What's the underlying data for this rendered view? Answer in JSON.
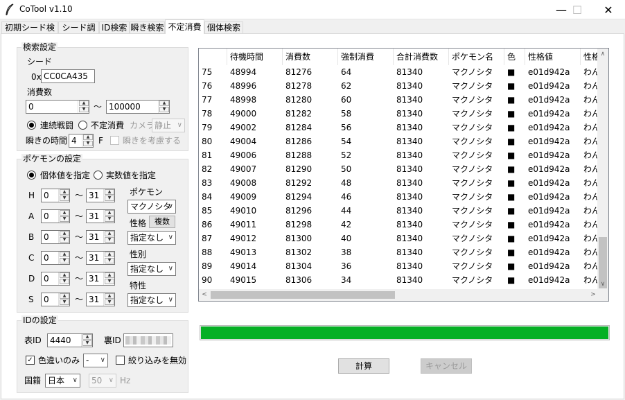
{
  "window": {
    "title": "CoTool v1.10"
  },
  "tabs": [
    {
      "label": "初期シード検索",
      "active": false
    },
    {
      "label": "シード調整",
      "active": false
    },
    {
      "label": "ID検索",
      "active": false
    },
    {
      "label": "瞬き検索",
      "active": false
    },
    {
      "label": "不定消費",
      "active": true
    },
    {
      "label": "個体検索",
      "active": false
    }
  ],
  "search": {
    "group_title": "検索設定",
    "seed_label": "シード",
    "seed_prefix": "0x",
    "seed_value": "CC0CA435",
    "consume_label": "消費数",
    "consume_min": "0",
    "consume_max": "100000",
    "tilde": "～",
    "mode_battle": "連続戦闘",
    "mode_indef": "不定消費",
    "camera_label": "カメラ",
    "camera_value": "静止",
    "blink_label": "瞬きの時間",
    "blink_value": "4",
    "blink_unit": "F",
    "blink_consider": "瞬きを考慮する"
  },
  "pokemon": {
    "group_title": "ポケモンの設定",
    "radio_iv": "個体値を指定",
    "radio_stat": "実数値を指定",
    "stats": [
      {
        "label": "H",
        "min": "0",
        "max": "31"
      },
      {
        "label": "A",
        "min": "0",
        "max": "31"
      },
      {
        "label": "B",
        "min": "0",
        "max": "31"
      },
      {
        "label": "C",
        "min": "0",
        "max": "31"
      },
      {
        "label": "D",
        "min": "0",
        "max": "31"
      },
      {
        "label": "S",
        "min": "0",
        "max": "31"
      }
    ],
    "species_label": "ポケモン",
    "species_value": "マクノシタ",
    "nature_label": "性格",
    "nature_multi": "複数",
    "nature_value": "指定なし",
    "gender_label": "性別",
    "gender_value": "指定なし",
    "ability_label": "特性",
    "ability_value": "指定なし"
  },
  "id": {
    "group_title": "IDの設定",
    "tid_label": "表ID",
    "tid_value": "4440",
    "sid_label": "裏ID",
    "shiny_label": "色違いのみ",
    "shiny_value": "-",
    "nofilter_label": "絞り込みを無効",
    "region_label": "国籍",
    "region_value": "日本",
    "hz_value": "50",
    "hz_unit": "Hz"
  },
  "table": {
    "headers": [
      "",
      "待機時間",
      "消費数",
      "強制消費",
      "合計消費数",
      "ポケモン名",
      "色",
      "性格値",
      "性格"
    ],
    "rows": [
      [
        "75",
        "48994",
        "81276",
        "64",
        "81340",
        "マクノシタ",
        "■",
        "e01d942a",
        "わん"
      ],
      [
        "76",
        "48996",
        "81278",
        "62",
        "81340",
        "マクノシタ",
        "■",
        "e01d942a",
        "わん"
      ],
      [
        "77",
        "48998",
        "81280",
        "60",
        "81340",
        "マクノシタ",
        "■",
        "e01d942a",
        "わん"
      ],
      [
        "78",
        "49000",
        "81282",
        "58",
        "81340",
        "マクノシタ",
        "■",
        "e01d942a",
        "わん"
      ],
      [
        "79",
        "49002",
        "81284",
        "56",
        "81340",
        "マクノシタ",
        "■",
        "e01d942a",
        "わん"
      ],
      [
        "80",
        "49004",
        "81286",
        "54",
        "81340",
        "マクノシタ",
        "■",
        "e01d942a",
        "わん"
      ],
      [
        "81",
        "49006",
        "81288",
        "52",
        "81340",
        "マクノシタ",
        "■",
        "e01d942a",
        "わん"
      ],
      [
        "82",
        "49007",
        "81290",
        "50",
        "81340",
        "マクノシタ",
        "■",
        "e01d942a",
        "わん"
      ],
      [
        "83",
        "49008",
        "81292",
        "48",
        "81340",
        "マクノシタ",
        "■",
        "e01d942a",
        "わん"
      ],
      [
        "84",
        "49009",
        "81294",
        "46",
        "81340",
        "マクノシタ",
        "■",
        "e01d942a",
        "わん"
      ],
      [
        "85",
        "49010",
        "81296",
        "44",
        "81340",
        "マクノシタ",
        "■",
        "e01d942a",
        "わん"
      ],
      [
        "86",
        "49011",
        "81298",
        "42",
        "81340",
        "マクノシタ",
        "■",
        "e01d942a",
        "わん"
      ],
      [
        "87",
        "49012",
        "81300",
        "40",
        "81340",
        "マクノシタ",
        "■",
        "e01d942a",
        "わん"
      ],
      [
        "88",
        "49013",
        "81302",
        "38",
        "81340",
        "マクノシタ",
        "■",
        "e01d942a",
        "わん"
      ],
      [
        "89",
        "49014",
        "81304",
        "36",
        "81340",
        "マクノシタ",
        "■",
        "e01d942a",
        "わん"
      ],
      [
        "90",
        "49015",
        "81306",
        "34",
        "81340",
        "マクノシタ",
        "■",
        "e01d942a",
        "わん"
      ]
    ]
  },
  "progress": {
    "value": 1.0,
    "color": "#06b025"
  },
  "actions": {
    "calc_label": "計算",
    "cancel_label": "キャンセル"
  }
}
